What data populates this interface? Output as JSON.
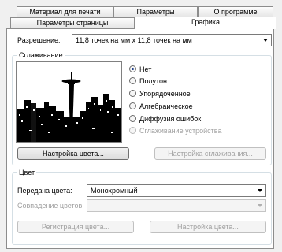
{
  "tabs": {
    "row_back": [
      "Материал для печати",
      "Параметры",
      "О программе"
    ],
    "row_front": [
      "Параметры страницы",
      "Графика"
    ],
    "active": "Графика"
  },
  "resolution": {
    "label": "Разрешение:",
    "value": "11,8 точек на мм x 11,8 точек на мм"
  },
  "dithering": {
    "group_title": "Сглаживание",
    "options": [
      {
        "label": "Нет",
        "checked": true,
        "disabled": false
      },
      {
        "label": "Полутон",
        "checked": false,
        "disabled": false
      },
      {
        "label": "Упорядоченное",
        "checked": false,
        "disabled": false
      },
      {
        "label": "Алгебраическое",
        "checked": false,
        "disabled": false
      },
      {
        "label": "Диффузия ошибок",
        "checked": false,
        "disabled": false
      },
      {
        "label": "Сглаживание устройства",
        "checked": false,
        "disabled": true
      }
    ],
    "color_setup_button": "Настройка цвета...",
    "dither_setup_button": "Настройка сглаживания..."
  },
  "color": {
    "group_title": "Цвет",
    "transfer_label": "Передача цвета:",
    "transfer_value": "Монохромный",
    "matching_label": "Совпадение цветов:",
    "matching_value": "",
    "register_button": "Регистрация цвета...",
    "setup_button": "Настройка цвета..."
  }
}
